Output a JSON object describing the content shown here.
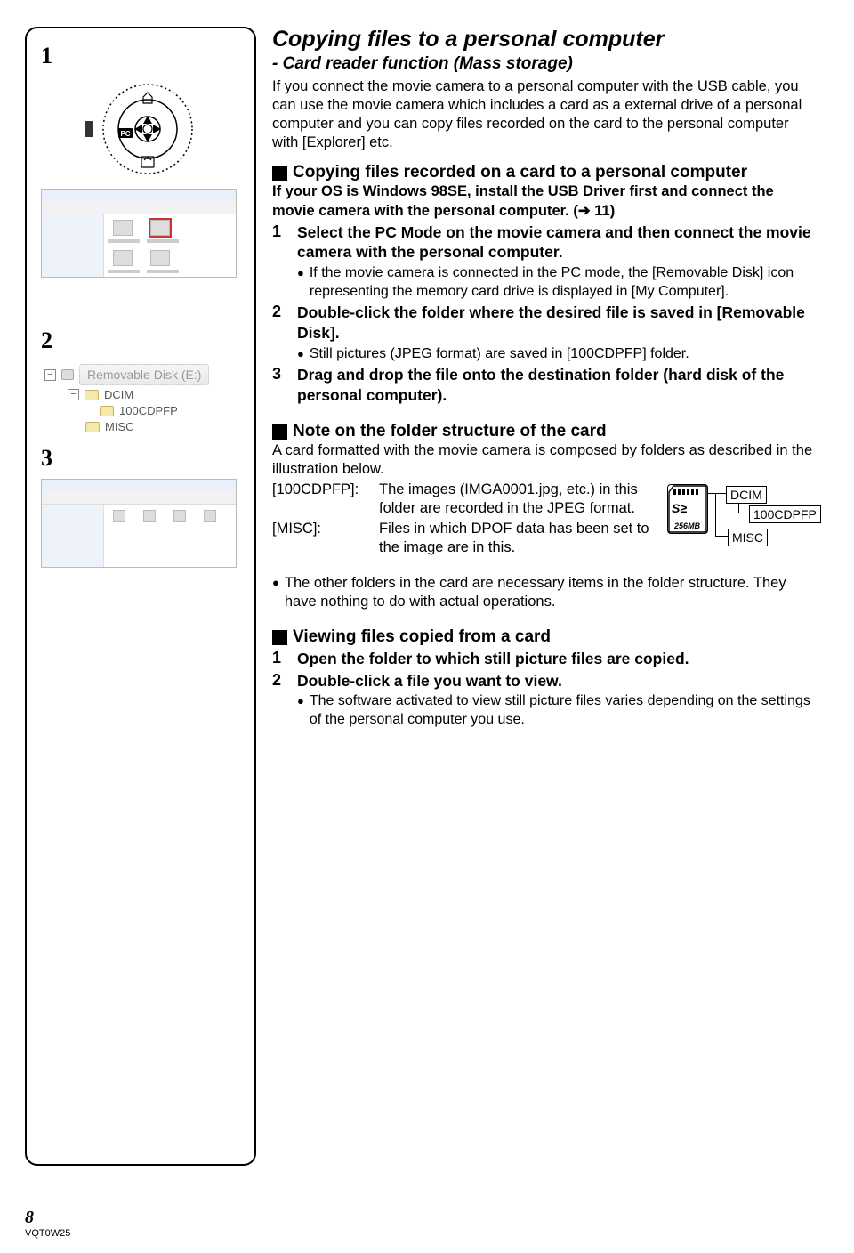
{
  "title": "Copying files to a personal computer",
  "subtitle": "- Card reader function (Mass storage)",
  "intro": "If you connect the movie camera to a personal computer with the USB cable, you can use the movie camera which includes a card as a external drive of a personal computer and you can copy files recorded on the card to the personal computer with [Explorer] etc.",
  "sec1": {
    "heading": "Copying files recorded on a card to a personal computer",
    "lead_bold": "If your OS is Windows 98SE, install the USB Driver first and connect the movie camera with the personal computer. (➔ 11)",
    "step1": {
      "num": "1",
      "bold": "Select the PC Mode on the movie camera and then connect the movie camera with the personal computer.",
      "bullet": "If the movie camera is connected in the PC mode, the [Removable Disk] icon representing the memory card drive is displayed in [My Computer]."
    },
    "step2": {
      "num": "2",
      "bold": "Double-click the folder where the desired file is saved in [Removable Disk].",
      "bullet": "Still pictures (JPEG format) are saved in [100CDPFP] folder."
    },
    "step3": {
      "num": "3",
      "bold": "Drag and drop the file onto the destination folder (hard disk of the personal computer)."
    }
  },
  "sec2": {
    "heading": "Note on the folder structure of the card",
    "para": "A card formatted with the movie camera is composed by folders as described in the illustration below.",
    "row1_label": "[100CDPFP]:",
    "row1_text": "The images (IMGA0001.jpg, etc.) in this folder are recorded in the JPEG format.",
    "row2_label": "[MISC]:",
    "row2_text": "Files in which DPOF data has been set to the image are in this.",
    "sd": {
      "logo": "S≥",
      "size": "256MB",
      "dcim": "DCIM",
      "cdpfp": "100CDPFP",
      "misc": "MISC"
    },
    "note_bullet": "The other folders in the card are necessary items in the folder structure. They have nothing to do with actual operations."
  },
  "sec3": {
    "heading": "Viewing files copied from a card",
    "step1": {
      "num": "1",
      "bold": "Open the folder to which still picture files are copied."
    },
    "step2": {
      "num": "2",
      "bold": "Double-click a file you want to view.",
      "bullet": "The software activated to view still picture files varies depending on the settings of the personal computer you use."
    }
  },
  "left": {
    "n1": "1",
    "n2": "2",
    "n3": "3",
    "drive_label": "Removable Disk (E:)",
    "tree": {
      "dcim": "DCIM",
      "cdpfp": "100CDPFP",
      "misc": "MISC"
    },
    "pc_badge": "PC"
  },
  "footer": {
    "page": "8",
    "code": "VQT0W25"
  }
}
